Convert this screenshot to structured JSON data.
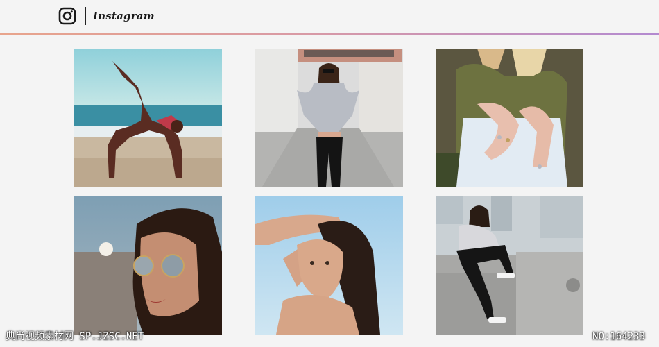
{
  "header": {
    "brand": "Instagram",
    "logo_icon": "instagram-camera-icon",
    "accent_gradient": [
      "#e8a48c",
      "#d99aa4",
      "#b38ad0"
    ]
  },
  "photos": [
    {
      "subject": "yoga-backbend-beach-photo"
    },
    {
      "subject": "woman-grey-sweater-street-photo"
    },
    {
      "subject": "hands-with-rings-photo"
    },
    {
      "subject": "woman-round-sunglasses-photo"
    },
    {
      "subject": "woman-hands-in-hair-photo"
    },
    {
      "subject": "woman-sitting-on-concrete-photo"
    }
  ],
  "watermark": {
    "left": "典尚视频素材网 SP.JZSC.NET",
    "right": "NO:164233"
  }
}
